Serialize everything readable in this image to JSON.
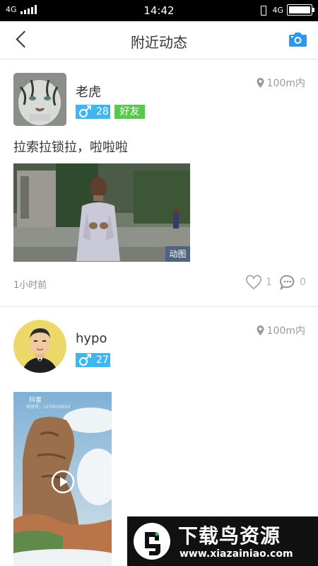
{
  "status_bar": {
    "network_left": "4G",
    "time": "14:42",
    "network_right": "4G",
    "battery_level": 1.0
  },
  "header": {
    "title": "附近动态",
    "back_icon": "chevron-left-icon",
    "camera_icon": "camera-icon"
  },
  "posts": [
    {
      "username": "老虎",
      "age": "28",
      "gender_icon": "male-icon",
      "friend_badge": "好友",
      "distance": "100m内",
      "text": "拉索拉锁拉，啦啦啦",
      "media_tag": "动图",
      "timestamp": "1小时前",
      "likes": "1",
      "comments": "0"
    },
    {
      "username": "hypo",
      "age": "27",
      "gender_icon": "male-icon",
      "distance": "100m内",
      "media_brand": "抖音",
      "media_id": "抖音号：1170019010"
    }
  ],
  "watermark": {
    "name": "下载鸟资源",
    "url": "www.xiazainiao.com"
  },
  "colors": {
    "accent_blue": "#3fb6ef",
    "friend_green": "#59c94e",
    "camera_blue": "#2f96e8"
  }
}
